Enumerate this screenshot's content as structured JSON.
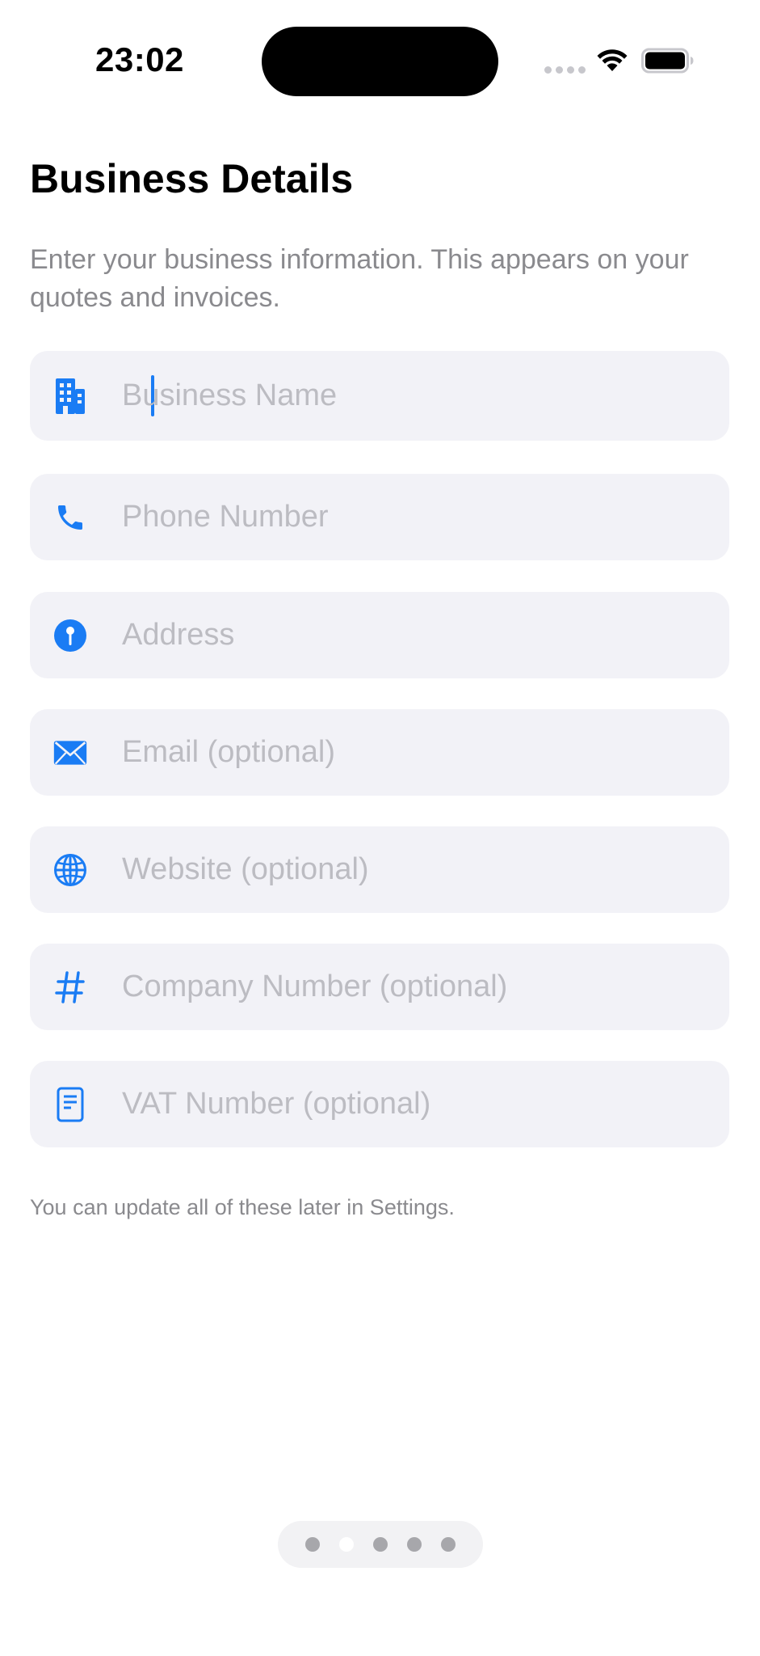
{
  "status_bar": {
    "time": "23:02"
  },
  "header": {
    "title": "Business Details",
    "subtitle": "Enter your business information. This appears on your quotes and invoices."
  },
  "form": {
    "fields": [
      {
        "placeholder": "Business Name",
        "value": "",
        "icon": "building-icon",
        "focused": true
      },
      {
        "placeholder": "Phone Number",
        "value": "",
        "icon": "phone-icon"
      },
      {
        "placeholder": "Address",
        "value": "",
        "icon": "map-pin-icon"
      },
      {
        "placeholder": "Email (optional)",
        "value": "",
        "icon": "envelope-icon"
      },
      {
        "placeholder": "Website (optional)",
        "value": "",
        "icon": "globe-icon"
      },
      {
        "placeholder": "Company Number (optional)",
        "value": "",
        "icon": "number-sign-icon"
      },
      {
        "placeholder": "VAT Number (optional)",
        "value": "",
        "icon": "document-icon"
      }
    ]
  },
  "footer": {
    "note": "You can update all of these later in Settings."
  },
  "pagination": {
    "total_pages": 5,
    "current_page": 2
  },
  "colors": {
    "accent": "#1a7cf4",
    "field_background": "#f2f2f7",
    "secondary_text": "#8a8a8e",
    "placeholder_text": "#bcbcc2"
  }
}
